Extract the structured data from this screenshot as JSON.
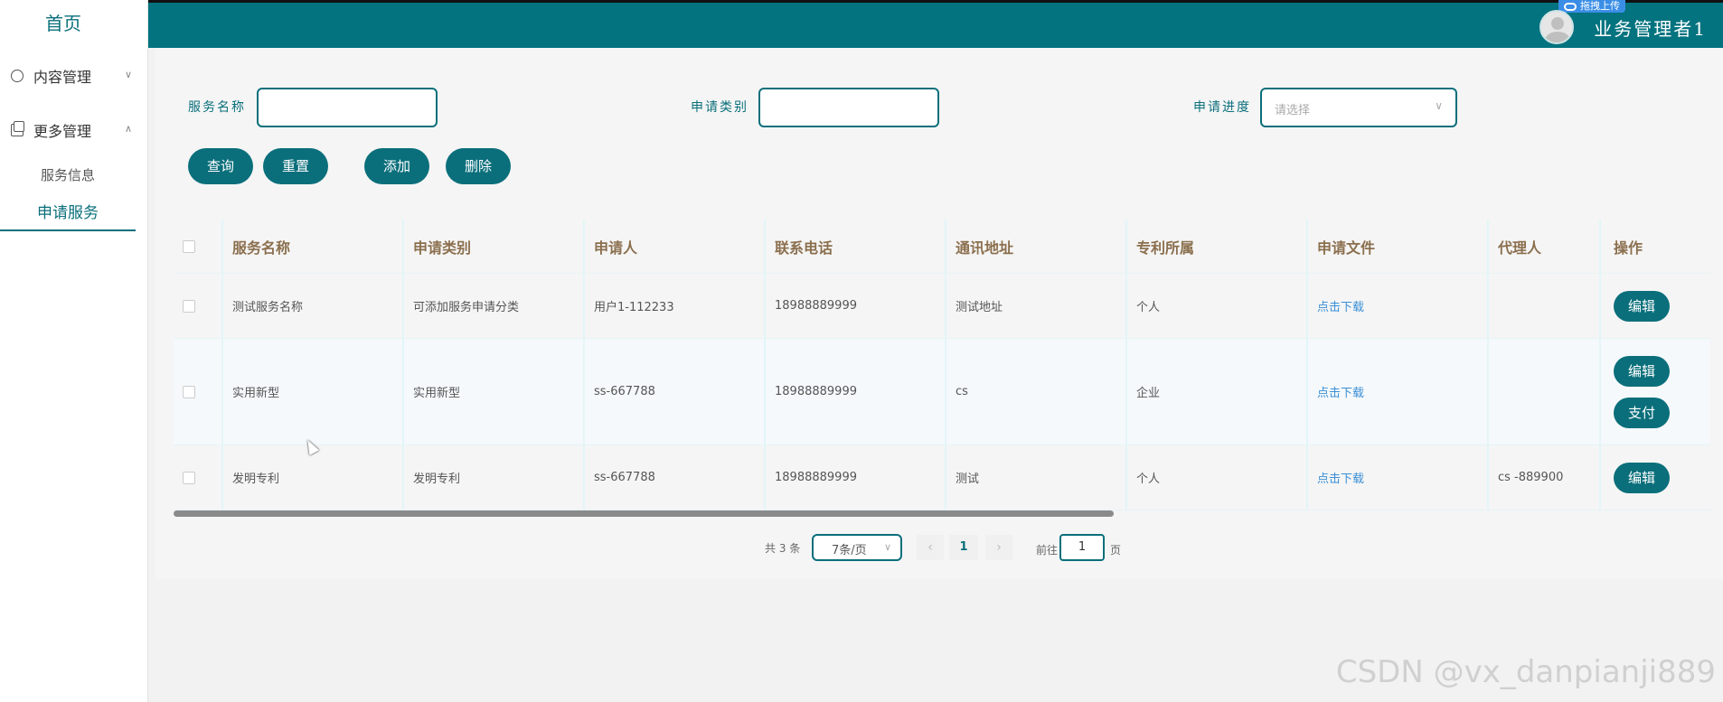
{
  "header": {
    "user_name": "业务管理者1",
    "upload_badge": "拖拽上传",
    "bg_color": "#02737f"
  },
  "sidebar": {
    "home": "首页",
    "menus": [
      {
        "label": "内容管理",
        "icon": "chat-icon",
        "state": "collapsed"
      },
      {
        "label": "更多管理",
        "icon": "copy-icon",
        "state": "expanded"
      }
    ],
    "submenus": [
      {
        "label": "服务信息"
      },
      {
        "label": "申请服务",
        "active": true
      }
    ]
  },
  "filters": {
    "service_name_label": "服务名称",
    "service_name_value": "",
    "category_label": "申请类别",
    "category_value": "",
    "progress_label": "申请进度",
    "progress_placeholder": "请选择"
  },
  "actions": {
    "query": "查询",
    "reset": "重置",
    "add": "添加",
    "delete": "删除"
  },
  "table": {
    "headers": [
      "服务名称",
      "申请类别",
      "申请人",
      "联系电话",
      "通讯地址",
      "专利所属",
      "申请文件",
      "代理人",
      "操作"
    ],
    "rows": [
      {
        "service": "测试服务名称",
        "category": "可添加服务申请分类",
        "applicant": "用户1-112233",
        "phone": "18988889999",
        "address": "测试地址",
        "owner": "个人",
        "file": "点击下载",
        "agent": "",
        "ops": [
          "编辑"
        ]
      },
      {
        "service": "实用新型",
        "category": "实用新型",
        "applicant": "ss-667788",
        "phone": "18988889999",
        "address": "cs",
        "owner": "企业",
        "file": "点击下载",
        "agent": "",
        "ops": [
          "编辑",
          "支付"
        ]
      },
      {
        "service": "发明专利",
        "category": "发明专利",
        "applicant": "ss-667788",
        "phone": "18988889999",
        "address": "测试",
        "owner": "个人",
        "file": "点击下载",
        "agent": "cs -889900",
        "ops": [
          "编辑"
        ]
      }
    ]
  },
  "pagination": {
    "total": "共 3 条",
    "page_size": "7条/页",
    "current_page": "1",
    "goto_prefix": "前往",
    "goto_value": "1",
    "goto_suffix": "页"
  },
  "watermark": "CSDN @vx_danpianji889"
}
